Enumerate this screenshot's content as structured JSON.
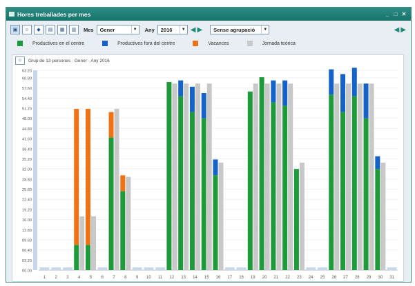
{
  "window": {
    "title": "Hores treballades per mes",
    "min_glyph": "_",
    "max_glyph": "□",
    "close_glyph": "✕"
  },
  "toolbar": {
    "icons": [
      "print-icon",
      "people-icon",
      "tag-icon",
      "calendar-icon",
      "grid-icon",
      "layout-icon"
    ],
    "mes_label": "Mes",
    "mes_value": "Gener",
    "any_label": "Any",
    "any_value": "2016",
    "grouping_value": "Sense agrupació",
    "prev_glyph": "◀",
    "next_glyph": "▶"
  },
  "legend": [
    {
      "label": "Productives en el centre",
      "color": "#1e9a3a"
    },
    {
      "label": "Productives fora del centre",
      "color": "#1563c9"
    },
    {
      "label": "Vacances",
      "color": "#f07215"
    },
    {
      "label": "Jornada teòrica",
      "color": "#c8c8c8"
    }
  ],
  "subtitle": "Grup de 13 persones · Gener · Any 2016",
  "chart_data": {
    "type": "bar",
    "stacked": true,
    "categories": [
      "1",
      "2",
      "3",
      "4",
      "5",
      "6",
      "7",
      "8",
      "9",
      "10",
      "11",
      "12",
      "13",
      "14",
      "15",
      "16",
      "17",
      "18",
      "19",
      "20",
      "21",
      "22",
      "23",
      "24",
      "25",
      "26",
      "27",
      "28",
      "29",
      "30",
      "31"
    ],
    "ylim": [
      0,
      63.2
    ],
    "y_ticks": [
      "00.00",
      "03.20",
      "06.40",
      "09.60",
      "12.80",
      "16.00",
      "19.20",
      "22.40",
      "25.60",
      "28.80",
      "32.00",
      "35.20",
      "38.40",
      "41.60",
      "44.80",
      "48.00",
      "51.20",
      "54.40",
      "57.60",
      "60.80",
      "63.20"
    ],
    "series": [
      {
        "name": "Productives en el centre",
        "values": [
          0,
          0,
          0,
          8,
          8,
          0,
          42,
          25,
          0,
          0,
          0,
          59.5,
          55,
          50,
          48,
          30,
          0,
          0,
          56.5,
          61,
          53,
          52,
          32,
          0,
          0,
          55.5,
          50,
          55,
          48,
          32,
          0
        ]
      },
      {
        "name": "Productives fora del centre",
        "values": [
          0,
          0,
          0,
          0,
          0,
          0,
          0,
          0,
          0,
          0,
          0,
          0,
          5,
          8,
          8,
          5,
          0,
          0,
          0,
          0,
          7,
          8,
          0,
          0,
          0,
          8,
          12,
          9,
          11,
          4,
          0
        ]
      },
      {
        "name": "Vacances",
        "values": [
          0,
          0,
          0,
          43,
          43,
          0,
          8,
          5,
          0,
          0,
          0,
          0,
          0,
          0,
          0,
          0,
          0,
          0,
          0,
          0,
          0,
          0,
          0,
          0,
          0,
          0,
          0,
          0,
          0,
          0,
          0
        ]
      },
      {
        "name": "Jornada teòrica",
        "values": [
          0,
          0,
          0,
          17,
          17,
          0,
          51,
          29.5,
          0,
          0,
          0,
          59,
          59,
          59,
          59,
          34,
          0,
          0,
          59,
          59,
          59,
          59,
          34,
          0,
          0,
          59,
          59,
          59,
          59,
          34,
          0
        ]
      }
    ]
  }
}
